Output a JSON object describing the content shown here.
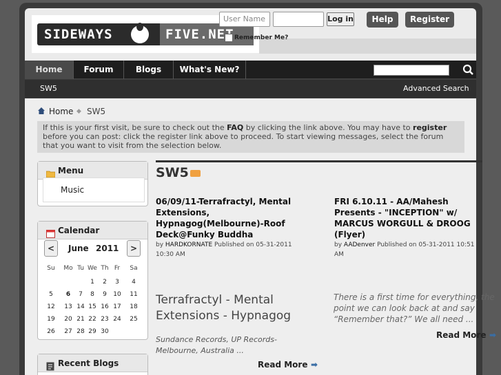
{
  "logo": {
    "left": "SIDEWAYS",
    "right": "FIVE.NET"
  },
  "login": {
    "user_placeholder": "User Name",
    "button": "Log in",
    "remember": "Remember Me?"
  },
  "top_buttons": {
    "help": "Help",
    "register": "Register"
  },
  "nav": {
    "tabs": [
      "Home",
      "Forum",
      "Blogs",
      "What's New?"
    ]
  },
  "subnav": {
    "current": "SW5",
    "advanced_search": "Advanced Search"
  },
  "breadcrumb": {
    "home": "Home",
    "current": "SW5"
  },
  "notice": {
    "t1": "If this is your first visit, be sure to check out the ",
    "faq": "FAQ",
    "t2": " by clicking the link above. You may have to ",
    "register": "register",
    "t3": " before you can post: click the register link above to proceed. To start viewing messages, select the forum that you want to visit from the selection below."
  },
  "sidebar": {
    "menu": {
      "title": "Menu",
      "items": [
        "Music"
      ]
    },
    "calendar": {
      "title": "Calendar",
      "prev": "<",
      "next": ">",
      "month": "June",
      "year": "2011",
      "dow": [
        "Su",
        "Mo",
        "Tu",
        "We",
        "Th",
        "Fr",
        "Sa"
      ],
      "weeks": [
        [
          "",
          "",
          "",
          "1",
          "2",
          "3",
          "4"
        ],
        [
          "5",
          "6",
          "7",
          "8",
          "9",
          "10",
          "11"
        ],
        [
          "12",
          "13",
          "14",
          "15",
          "16",
          "17",
          "18"
        ],
        [
          "19",
          "20",
          "21",
          "22",
          "23",
          "24",
          "25"
        ],
        [
          "26",
          "27",
          "28",
          "29",
          "30",
          "",
          ""
        ]
      ],
      "today": "6"
    },
    "recent_blogs": {
      "title": "Recent Blogs"
    }
  },
  "main": {
    "title": "SW5",
    "articles": [
      {
        "title_lines": [
          "06/09/11-Terrafractyl, Mental",
          "Extensions,",
          "Hypnagog(Melbourne)-Roof",
          "Deck@Funky Buddha"
        ],
        "by": "by ",
        "author": "HARDKORNATE",
        "published": " Published on 05-31-2011",
        "time": "10:30 AM"
      },
      {
        "title_lines": [
          "FRI 6.10.11 - AA/Mahesh",
          "Presents - \"INCEPTION\" w/",
          "MARCUS WORGULL & DROOG",
          "(Flyer)"
        ],
        "by": "by ",
        "author": "AADenver",
        "published": " Published on 05-31-2011 10:51",
        "time": "AM"
      }
    ],
    "feature": {
      "title_lines": [
        "Terrafractyl - Mental",
        "Extensions - Hypnagog"
      ],
      "info_lines": [
        "Sundance Records, UP Records-",
        "Melbourne, Australia ..."
      ],
      "quote_lines": [
        "There is a first time for everything, the",
        "point we can look back at and say",
        "“Remember that?” We all need ..."
      ],
      "read_more": "Read More"
    }
  }
}
